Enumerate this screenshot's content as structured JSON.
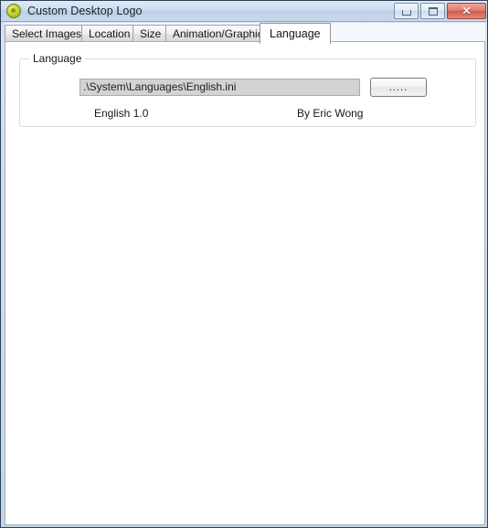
{
  "window": {
    "title": "Custom Desktop Logo",
    "icon": "app-logo-icon",
    "accent_color": "#cdd93a",
    "titlebar_color": "#cfdef0",
    "border_color": "#2e4157",
    "controls": {
      "minimize": "minimize-icon",
      "maximize": "maximize-icon",
      "close_label": "✕",
      "close_color": "#cf5c4e"
    }
  },
  "tabs": [
    {
      "label": "Select Images",
      "selected": false
    },
    {
      "label": "Location",
      "selected": false
    },
    {
      "label": "Size",
      "selected": false
    },
    {
      "label": "Animation/Graphics",
      "selected": false
    },
    {
      "label": "Language",
      "selected": true
    }
  ],
  "language_group": {
    "legend": "Language",
    "path_field": {
      "value": ".\\System\\Languages\\English.ini",
      "placeholder": "",
      "background": "#d3d3d3"
    },
    "browse_button_label": ".....",
    "version_label": "English 1.0",
    "author_label": "By Eric Wong"
  }
}
